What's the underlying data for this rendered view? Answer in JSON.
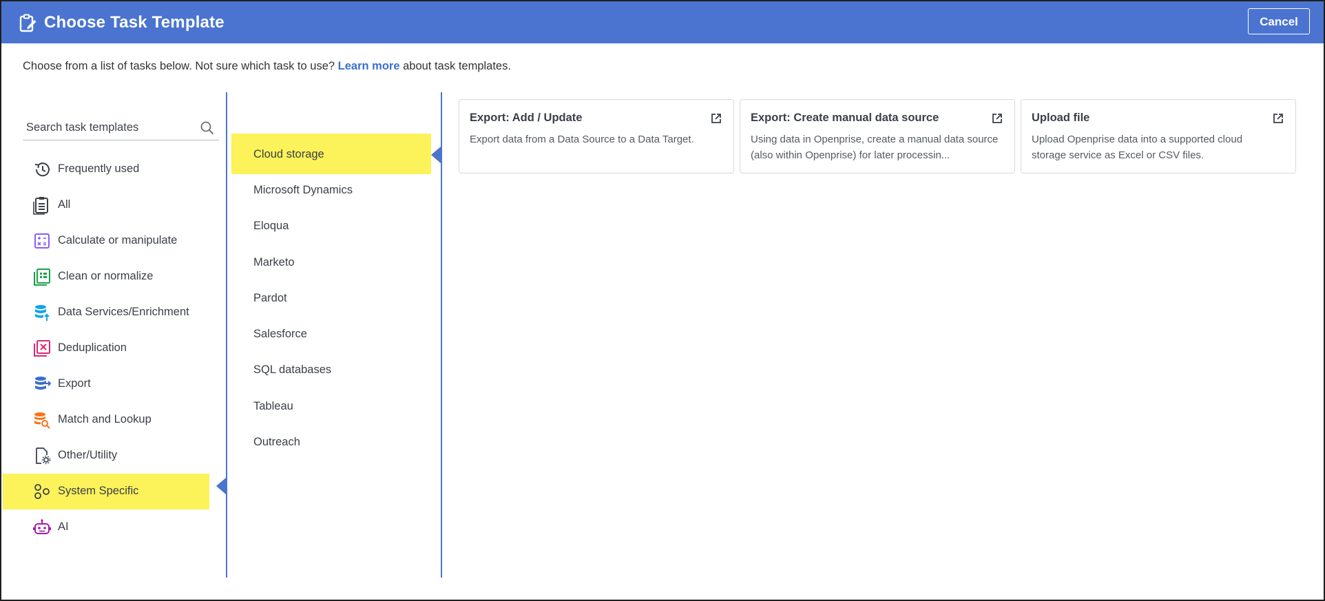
{
  "header": {
    "title": "Choose Task Template",
    "cancel_label": "Cancel",
    "icon": "clipboard-edit-icon"
  },
  "intro": {
    "before": "Choose from a list of tasks below. Not sure which task to use? ",
    "link": "Learn more",
    "after": " about task templates."
  },
  "search": {
    "placeholder": "Search task templates",
    "value": ""
  },
  "categories": [
    {
      "label": "Frequently used",
      "icon": "history-icon"
    },
    {
      "label": "All",
      "icon": "clipboard-list-icon"
    },
    {
      "label": "Calculate or manipulate",
      "icon": "calculator-icon"
    },
    {
      "label": "Clean or normalize",
      "icon": "spreadsheet-icon"
    },
    {
      "label": "Data Services/Enrichment",
      "icon": "database-upload-icon"
    },
    {
      "label": "Deduplication",
      "icon": "deduplicate-icon"
    },
    {
      "label": "Export",
      "icon": "database-export-icon"
    },
    {
      "label": "Match and Lookup",
      "icon": "database-search-icon"
    },
    {
      "label": "Other/Utility",
      "icon": "file-settings-icon"
    },
    {
      "label": "System Specific",
      "icon": "shapes-icon"
    },
    {
      "label": "AI",
      "icon": "robot-icon"
    }
  ],
  "active_category": "System Specific",
  "systems": [
    {
      "label": "Cloud storage"
    },
    {
      "label": "Microsoft Dynamics"
    },
    {
      "label": "Eloqua"
    },
    {
      "label": "Marketo"
    },
    {
      "label": "Pardot"
    },
    {
      "label": "Salesforce"
    },
    {
      "label": "SQL databases"
    },
    {
      "label": "Tableau"
    },
    {
      "label": "Outreach"
    }
  ],
  "active_system": "Cloud storage",
  "cards": [
    {
      "title": "Export: Add / Update",
      "description": "Export data from a Data Source to a Data Target."
    },
    {
      "title": "Export: Create manual data source",
      "description": "Using data in Openprise, create a manual data source (also within Openprise) for later processin..."
    },
    {
      "title": "Upload file",
      "description": "Upload Openprise data into a supported cloud storage service as Excel or CSV files."
    }
  ],
  "colors": {
    "header": "#4a74d0",
    "highlight": "#fcf25a",
    "link": "#3b6fcf"
  }
}
